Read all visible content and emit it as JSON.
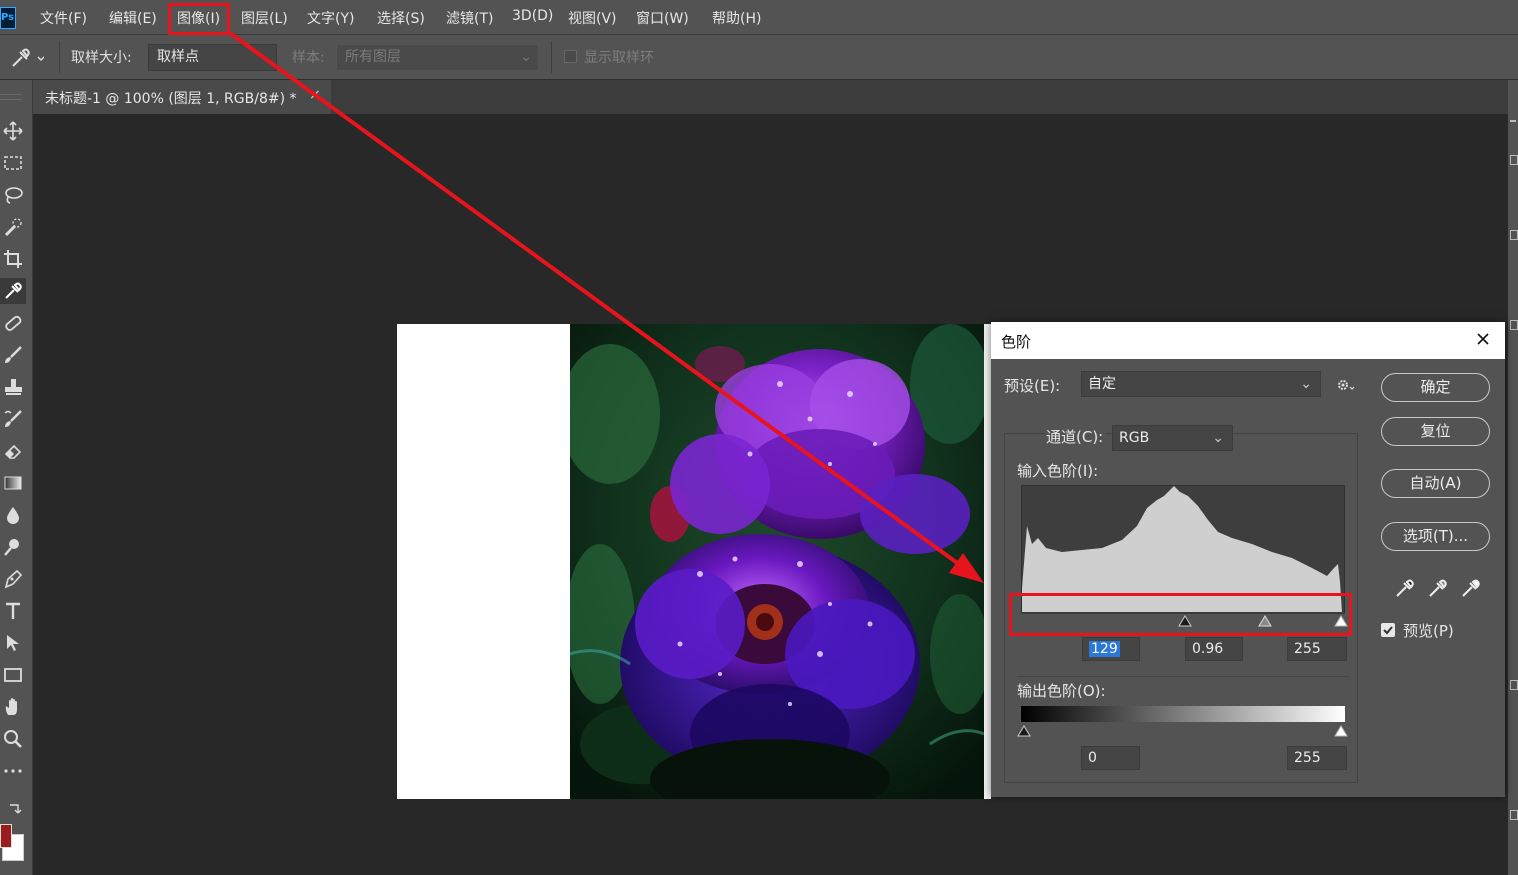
{
  "app": {
    "logo": "Ps"
  },
  "menubar": {
    "items": [
      "文件(F)",
      "编辑(E)",
      "图像(I)",
      "图层(L)",
      "文字(Y)",
      "选择(S)",
      "滤镜(T)",
      "3D(D)",
      "视图(V)",
      "窗口(W)",
      "帮助(H)"
    ],
    "highlighted": "图像(I)"
  },
  "options": {
    "sample_size_label": "取样大小:",
    "sample_size_value": "取样点",
    "sample_label": "样本:",
    "sample_value": "所有图层",
    "show_ring_label": "显示取样环"
  },
  "document": {
    "tab_title": "未标题-1 @ 100% (图层 1, RGB/8#) *",
    "close": "×"
  },
  "tools": [
    "move-icon",
    "marquee-icon",
    "lasso-icon",
    "quick-select-icon",
    "crop-icon",
    "eyedropper-icon",
    "healing-icon",
    "brush-icon",
    "stamp-icon",
    "history-brush-icon",
    "eraser-icon",
    "gradient-icon",
    "blur-icon",
    "dodge-icon",
    "pen-icon",
    "type-icon",
    "path-select-icon",
    "rectangle-icon",
    "hand-icon",
    "zoom-icon",
    "more-icon"
  ],
  "colors": {
    "foreground": "#9b1c1c",
    "background": "#ffffff",
    "annotation_red": "#e8141d"
  },
  "levels_dialog": {
    "title": "色阶",
    "preset_label": "预设(E):",
    "preset_value": "自定",
    "channel_label": "通道(C):",
    "channel_value": "RGB",
    "input_levels_label": "输入色阶(I):",
    "output_levels_label": "输出色阶(O):",
    "input_black": "129",
    "input_gamma": "0.96",
    "input_white": "255",
    "output_black": "0",
    "output_white": "255",
    "buttons": {
      "ok": "确定",
      "reset": "复位",
      "auto": "自动(A)",
      "options": "选项(T)..."
    },
    "preview_label": "预览(P)",
    "preview_checked": true
  }
}
